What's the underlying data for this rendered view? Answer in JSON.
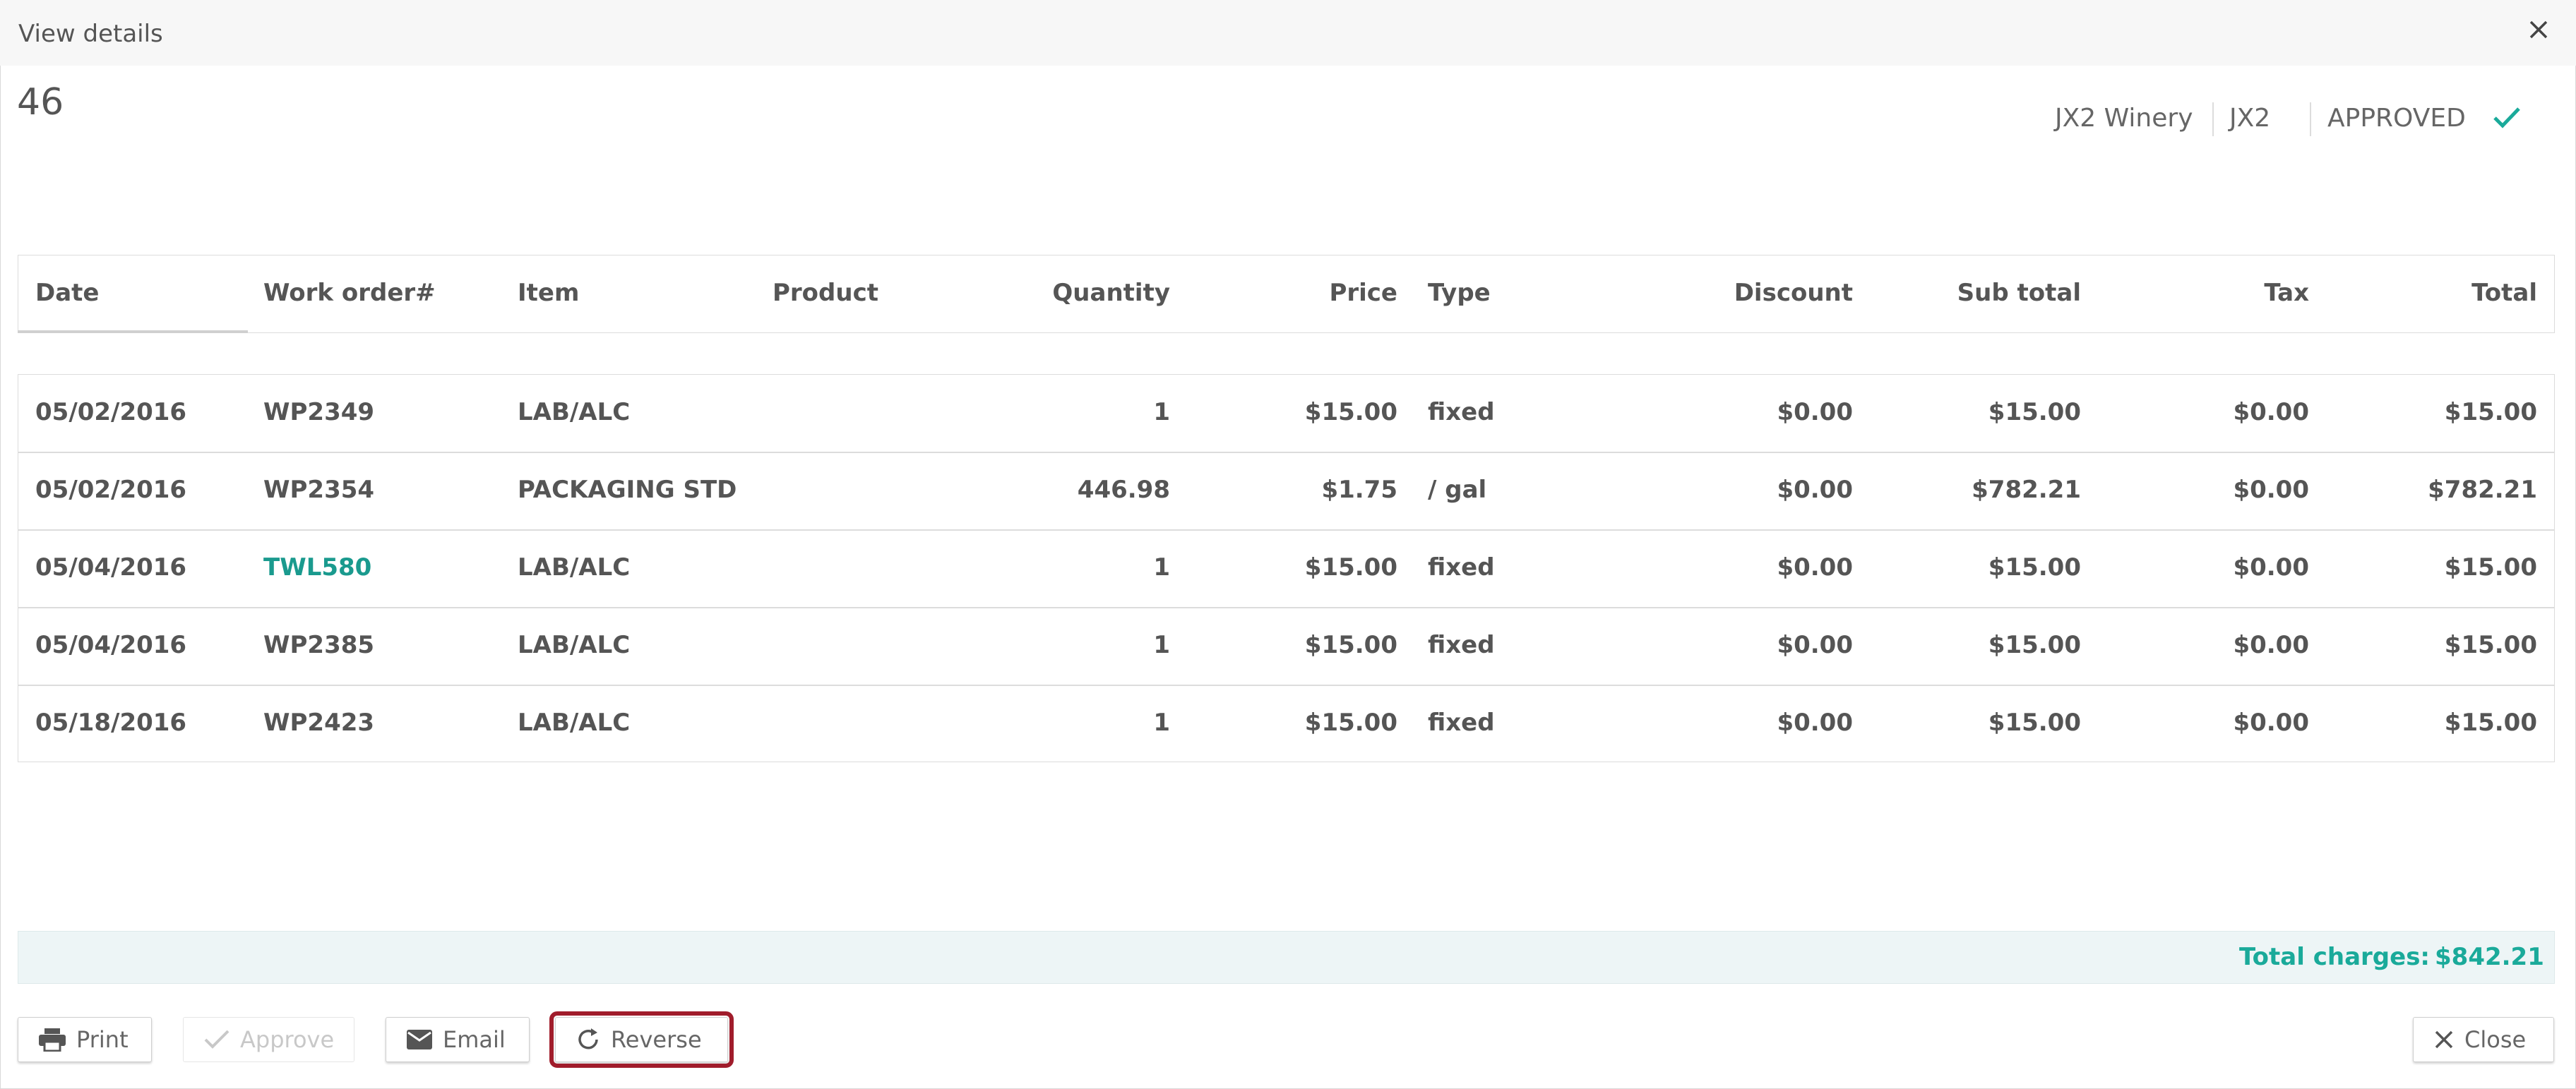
{
  "dialog": {
    "title": "View details",
    "close_icon": "close-icon"
  },
  "record": {
    "number": "46",
    "winery": "JX2 Winery",
    "code": "JX2",
    "status": "APPROVED",
    "status_color": "#1aaa9a"
  },
  "table": {
    "headers": [
      "Date",
      "Work order#",
      "Item",
      "Product",
      "Quantity",
      "Price",
      "Type",
      "Discount",
      "Sub total",
      "Tax",
      "Total"
    ],
    "rows": [
      {
        "date": "05/02/2016",
        "work_order": "WP2349",
        "item": "LAB/ALC",
        "product": "",
        "quantity": "1",
        "price": "$15.00",
        "type": "fixed",
        "discount": "$0.00",
        "subtotal": "$15.00",
        "tax": "$0.00",
        "total": "$15.00"
      },
      {
        "date": "05/02/2016",
        "work_order": "WP2354",
        "item": "PACKAGING STD",
        "product": "",
        "quantity": "446.98",
        "price": "$1.75",
        "type": "/ gal",
        "discount": "$0.00",
        "subtotal": "$782.21",
        "tax": "$0.00",
        "total": "$782.21"
      },
      {
        "date": "05/04/2016",
        "work_order": "TWL580",
        "item": "LAB/ALC",
        "product": "",
        "quantity": "1",
        "price": "$15.00",
        "type": "fixed",
        "discount": "$0.00",
        "subtotal": "$15.00",
        "tax": "$0.00",
        "total": "$15.00"
      },
      {
        "date": "05/04/2016",
        "work_order": "WP2385",
        "item": "LAB/ALC",
        "product": "",
        "quantity": "1",
        "price": "$15.00",
        "type": "fixed",
        "discount": "$0.00",
        "subtotal": "$15.00",
        "tax": "$0.00",
        "total": "$15.00"
      },
      {
        "date": "05/18/2016",
        "work_order": "WP2423",
        "item": "LAB/ALC",
        "product": "",
        "quantity": "1",
        "price": "$15.00",
        "type": "fixed",
        "discount": "$0.00",
        "subtotal": "$15.00",
        "tax": "$0.00",
        "total": "$15.00"
      }
    ],
    "link_color": "#1a9a8e"
  },
  "totals": {
    "label": "Total charges:",
    "value": "$842.21"
  },
  "footer": {
    "print_label": "Print",
    "approve_label": "Approve",
    "email_label": "Email",
    "reverse_label": "Reverse",
    "close_label": "Close"
  }
}
